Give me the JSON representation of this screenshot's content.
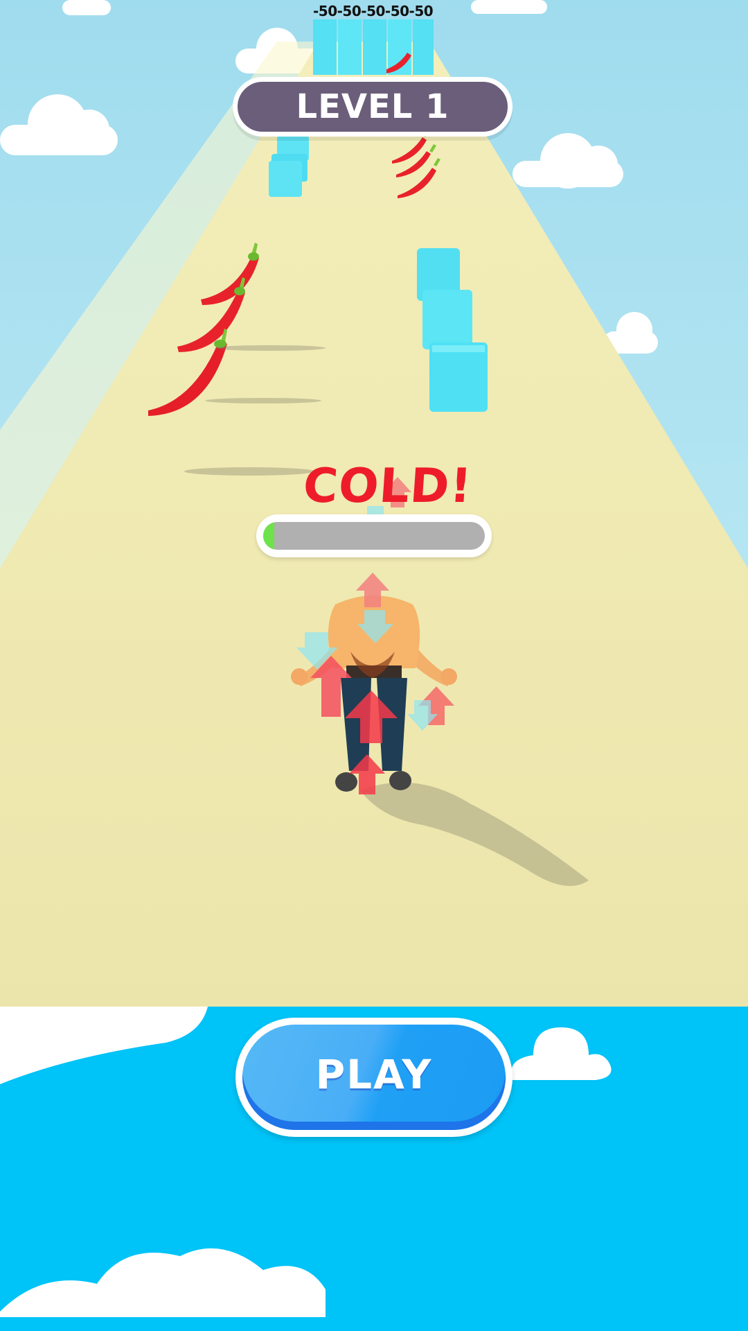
{
  "hud": {
    "distance_labels": "-50-50-50-50-50",
    "level_label": "LEVEL 1",
    "status_word": "COLD!",
    "temperature_level": 0.05
  },
  "colors": {
    "track": "#efe8ae",
    "chili": "#e8222a",
    "ice": "#58e6f6",
    "sky_bottom": "#00c3f7",
    "level_pill": "#6b5e7a",
    "status_text": "#ee1c2a",
    "bar_fill": "#6ee24a",
    "play_button": "#2aa3f6"
  },
  "actions": {
    "play_label": "PLAY"
  }
}
